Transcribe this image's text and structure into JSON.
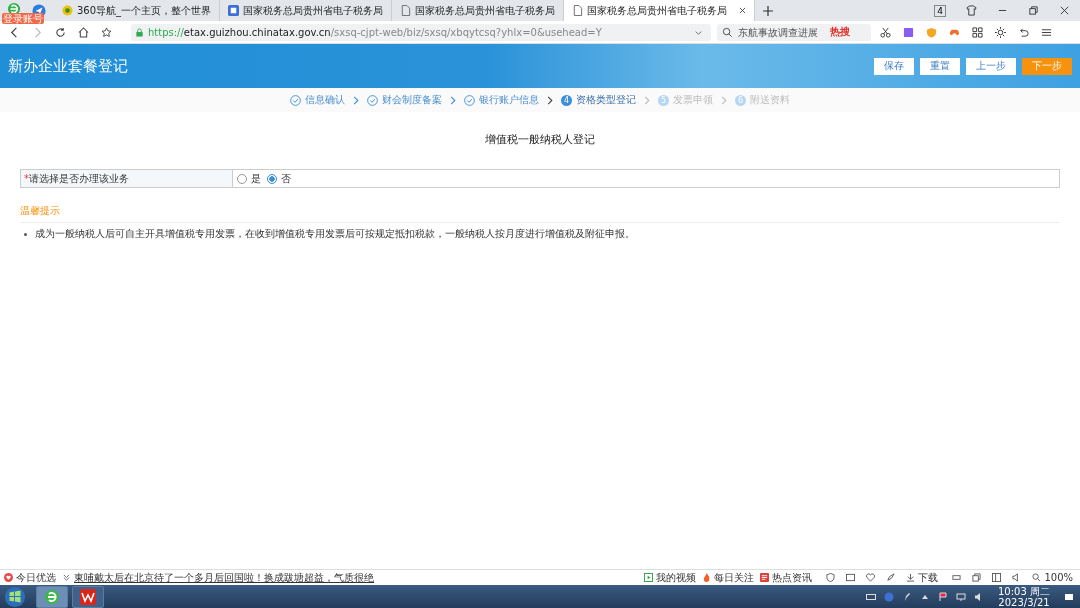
{
  "browser": {
    "badge": "登录账号",
    "tabs": [
      {
        "label": "360导航_一个主页，整个世界",
        "selected": false
      },
      {
        "label": "国家税务总局贵州省电子税务局",
        "selected": false
      },
      {
        "label": "国家税务总局贵州省电子税务局",
        "selected": false
      },
      {
        "label": "国家税务总局贵州省电子税务局",
        "selected": true
      }
    ],
    "tab_count": "4",
    "url_secure": "https://",
    "url_host": "etax.guizhou.chinatax.gov.cn",
    "url_path": "/sxsq-cjpt-web/biz/sxsq/xbqytcsq?yhlx=0&usehead=Y",
    "search_placeholder": "东航事故调查进展",
    "hot_label": "热搜"
  },
  "header": {
    "title": "新办企业套餐登记",
    "buttons": [
      {
        "label": "保存",
        "primary": false
      },
      {
        "label": "重置",
        "primary": false
      },
      {
        "label": "上一步",
        "primary": false
      },
      {
        "label": "下一步",
        "primary": true
      }
    ]
  },
  "steps": [
    {
      "label": "信息确认",
      "done": true,
      "current": false
    },
    {
      "label": "财会制度备案",
      "done": true,
      "current": false
    },
    {
      "label": "银行账户信息",
      "done": true,
      "current": false
    },
    {
      "label": "资格类型登记",
      "done": false,
      "current": true,
      "number": "4"
    },
    {
      "label": "发票申领",
      "done": false,
      "current": false,
      "number": "5"
    },
    {
      "label": "附送资料",
      "done": false,
      "current": false,
      "number": "6"
    }
  ],
  "form": {
    "title": "增值税一般纳税人登记",
    "question": "请选择是否办理该业务",
    "required_mark": "*",
    "options": [
      {
        "label": "是",
        "selected": false
      },
      {
        "label": "否",
        "selected": true
      }
    ]
  },
  "tips": {
    "title": "温馨提示",
    "items": [
      "成为一般纳税人后可自主开具增值税专用发票，在收到增值税专用发票后可按规定抵扣税款，一般纳税人按月度进行增值税及附征申报。"
    ]
  },
  "status_bar": {
    "left": "今日优选",
    "news": "東哺戴太后在北京待了一个多月后回国啦！换成跋塘超益，气质很绝",
    "links": [
      "我的视频",
      "每日关注",
      "热点资讯"
    ],
    "download": "下载",
    "zoom": "100%"
  },
  "taskbar": {
    "time": "10:03 周二",
    "date": "2023/3/21"
  }
}
